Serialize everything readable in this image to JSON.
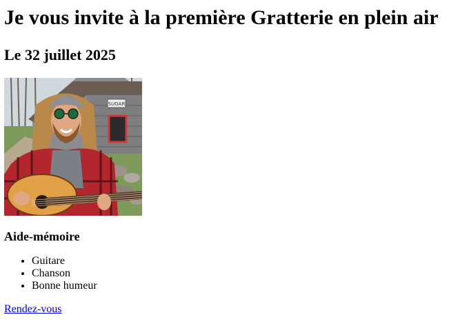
{
  "heading": "Je vous invite à la première Gratterie en plein air",
  "date": "Le 32 juillet 2025",
  "image": {
    "description_icon": "guitarist-photo",
    "sign_text": "SUGAR"
  },
  "reminder": {
    "title": "Aide-mémoire",
    "items": [
      "Guitare",
      "Chanson",
      "Bonne humeur"
    ]
  },
  "link_label": "Rendez-vous",
  "colors": {
    "link": "#0000ee",
    "text": "#000000",
    "background": "#ffffff"
  }
}
